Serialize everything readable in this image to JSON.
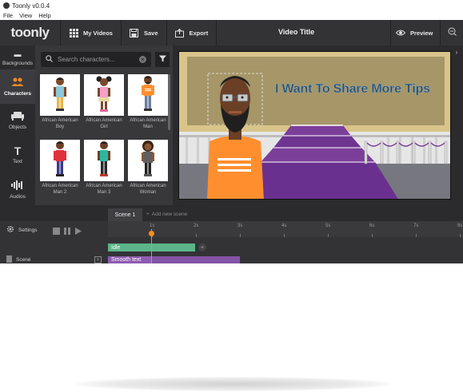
{
  "window": {
    "title": "Toonly v0.0.4"
  },
  "menu": {
    "items": [
      "File",
      "View",
      "Help"
    ]
  },
  "toolbar": {
    "brand": "toonly",
    "my_videos": "My Videos",
    "save": "Save",
    "export": "Export",
    "video_title": "Video Title",
    "preview": "Preview"
  },
  "sidebar": {
    "items": [
      {
        "label": "Backgrounds",
        "icon": "image-icon"
      },
      {
        "label": "Characters",
        "icon": "people-icon",
        "active": true
      },
      {
        "label": "Objects",
        "icon": "sofa-icon"
      },
      {
        "label": "Text",
        "icon": "text-icon"
      },
      {
        "label": "Audios",
        "icon": "audio-icon"
      }
    ]
  },
  "library": {
    "search_placeholder": "Search characters...",
    "characters": [
      {
        "label": "African American Boy",
        "shirt": "#8fc8d8",
        "pants": "#e7b54a",
        "hair": "boy"
      },
      {
        "label": "African American Girl",
        "shirt": "#f4a0c8",
        "pants": "#e8d8a0",
        "hair": "girl"
      },
      {
        "label": "African American Man",
        "shirt": "#ff8f2e",
        "pants": "#6a7fa0",
        "hair": "man"
      },
      {
        "label": "African American Man 2",
        "shirt": "#e0323c",
        "pants": "#3a3a8a",
        "hair": "man2"
      },
      {
        "label": "African American Man 3",
        "shirt": "#2ab9a0",
        "pants": "#2a2a2a",
        "hair": "man3"
      },
      {
        "label": "African American Woman",
        "shirt": "#444",
        "pants": "#222",
        "hair": "woman"
      }
    ]
  },
  "stage": {
    "headline": "I Want To Share More Tips"
  },
  "scenes": {
    "active_tab": "Scene 1",
    "add_label": "Add new scene"
  },
  "timeline": {
    "settings_label": "Settings",
    "ticks": [
      "1s",
      "2s",
      "3s",
      "4s",
      "5s",
      "6s",
      "7s",
      "8s"
    ],
    "tracks": {
      "idle_label": "Idle",
      "scene_label": "Scene",
      "text_label": "Smooth text"
    }
  },
  "colors": {
    "accent": "#ff8c1a",
    "idle_track": "#5cb58a",
    "text_track": "#8e5bb0",
    "headline": "#1f4f70"
  }
}
